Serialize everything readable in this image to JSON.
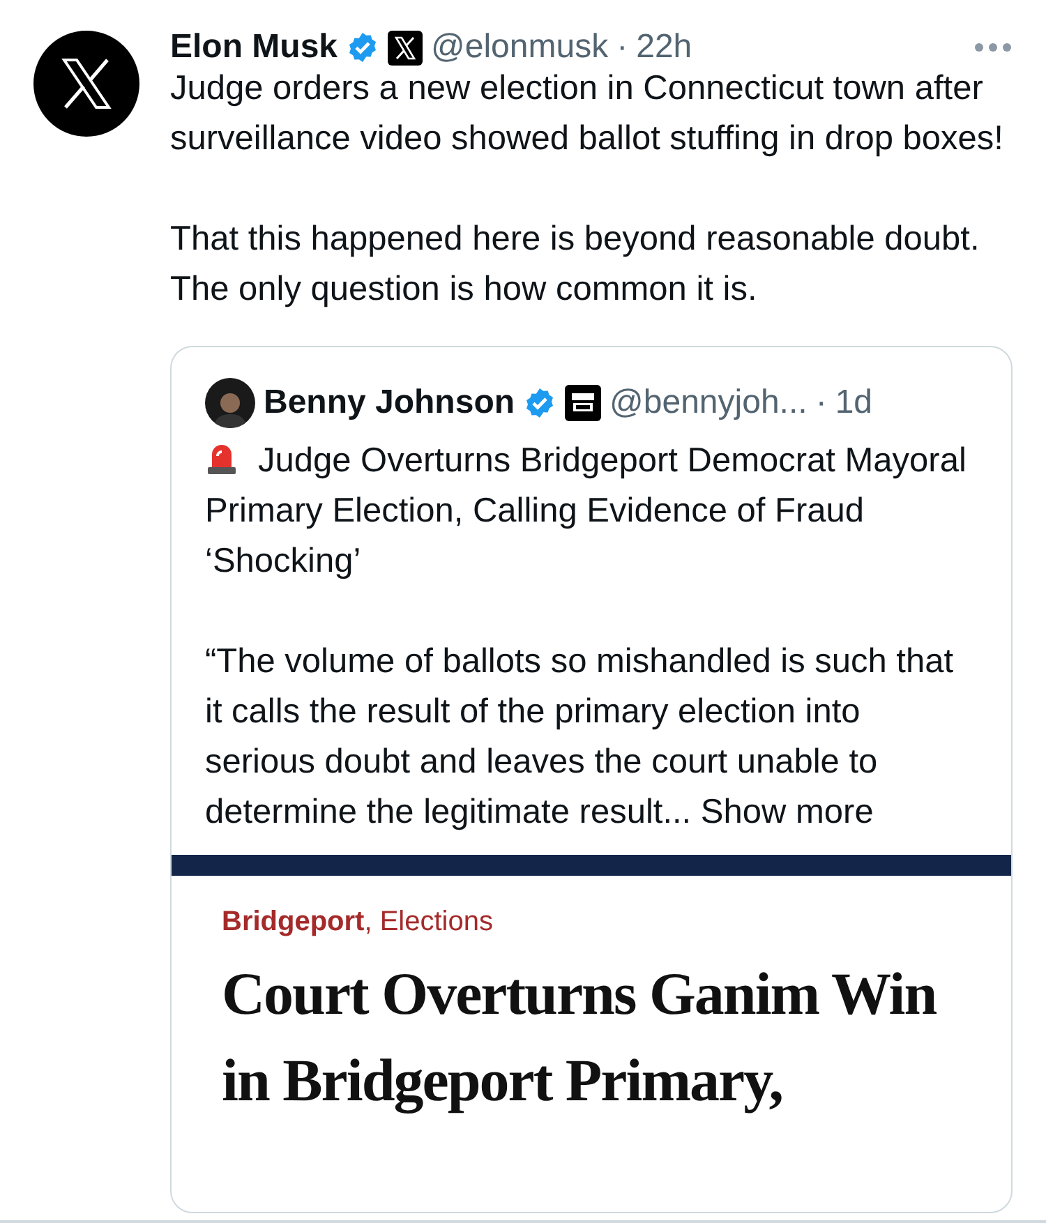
{
  "post": {
    "author": "Elon Musk",
    "verified": true,
    "handle": "@elonmusk",
    "separator": "·",
    "time": "22h",
    "paragraphs": [
      "Judge orders a new election in Connecticut town after surveillance video showed ballot stuffing in drop boxes!",
      "That this happened here is beyond reasonable doubt. The only question is how common it is."
    ]
  },
  "quote": {
    "author": "Benny Johnson",
    "verified": true,
    "handle": "@bennyjoh...",
    "separator": "·",
    "time": "1d",
    "headline": "Judge Overturns Bridgeport Democrat Mayoral Primary Election, Calling Evidence of Fraud ‘Shocking’",
    "excerpt": "“The volume of ballots so mishandled is such that it calls the result of the primary election into serious doubt and leaves the court unable to determine the legitimate result...",
    "show_more": "Show more"
  },
  "article": {
    "section": "Bridgeport",
    "topic": ", Elections",
    "title_lines": [
      "Court Overturns Ganim Win",
      "in Bridgeport Primary,"
    ]
  }
}
